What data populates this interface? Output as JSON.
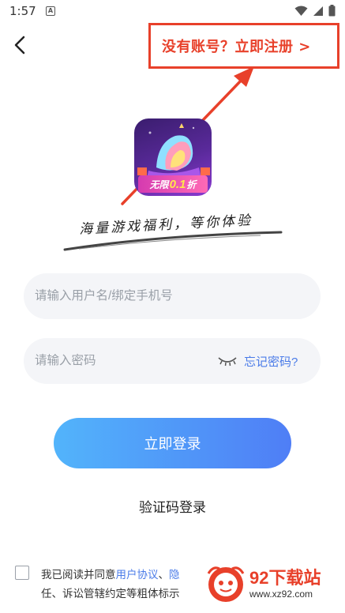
{
  "status_bar": {
    "time": "1:57",
    "notification_icon": "a-letter-icon",
    "icons": [
      "wifi-icon",
      "signal-icon",
      "battery-icon"
    ]
  },
  "header": {
    "back_icon": "chevron-left-icon",
    "register_link": "没有账号？立即注册 >"
  },
  "logo": {
    "badge_text_1": "无限",
    "badge_text_2": "0.1",
    "badge_text_3": "折"
  },
  "slogan": "海量游戏福利，等你体验",
  "form": {
    "username_placeholder": "请输入用户名/绑定手机号",
    "password_placeholder": "请输入密码",
    "forgot_password": "忘记密码?",
    "login_button": "立即登录",
    "sms_login": "验证码登录"
  },
  "agreement": {
    "line1_prefix": "我已阅读并同意",
    "user_agreement": "用户协议",
    "line1_sep": "、",
    "privacy_partial": "隐",
    "line2": "任、诉讼管辖约定等粗体标示"
  },
  "watermark": {
    "title": "92下载站",
    "url": "www.xz92.com"
  },
  "colors": {
    "accent_red": "#e8402a",
    "link_blue": "#4a7be8",
    "button_gradient_start": "#52b4fb",
    "button_gradient_end": "#4f7ef6"
  }
}
